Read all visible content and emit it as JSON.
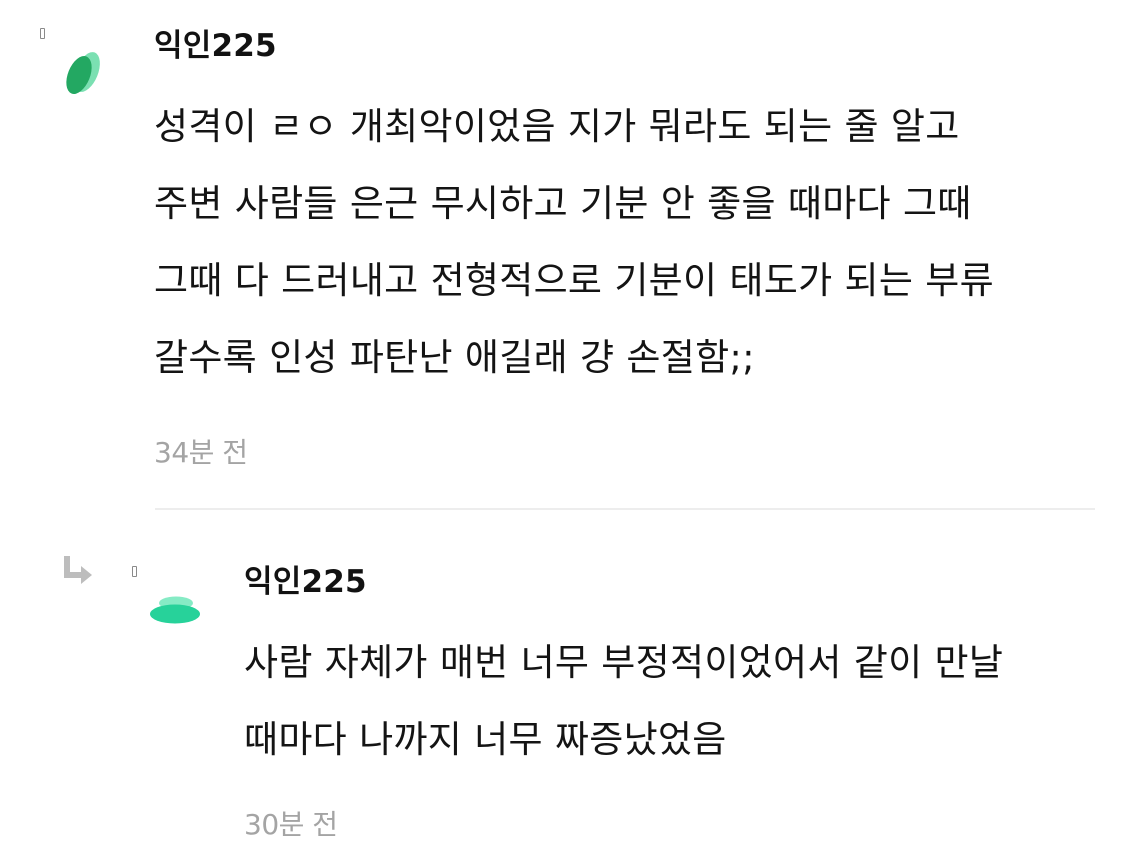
{
  "comments": [
    {
      "author": "익인225",
      "text": "성격이 ㄹㅇ 개최악이었음 지가 뭐라도 되는 줄 알고\n주변 사람들 은근 무시하고 기분 안 좋을 때마다 그때\n그때 다 드러내고 전형적으로 기분이 태도가 되는 부류\n갈수록 인성 파탄난 애길래 걍 손절함;;",
      "time": "34분 전",
      "avatar_icon": "green-leaf-avatar-icon",
      "avatar_color": "#2ec27e"
    }
  ],
  "reply": {
    "author": "익인225",
    "text": "사람 자체가 매번 너무 부정적이었어서 같이 만날\n때마다 나까지 너무 짜증났었음",
    "time": "30분 전",
    "avatar_icon": "green-stacked-disc-avatar-icon",
    "avatar_color": "#27d29a",
    "reply_icon": "reply-arrow-icon"
  },
  "colors": {
    "text": "#141414",
    "muted": "#a4a4a4",
    "divider": "#ededed"
  }
}
